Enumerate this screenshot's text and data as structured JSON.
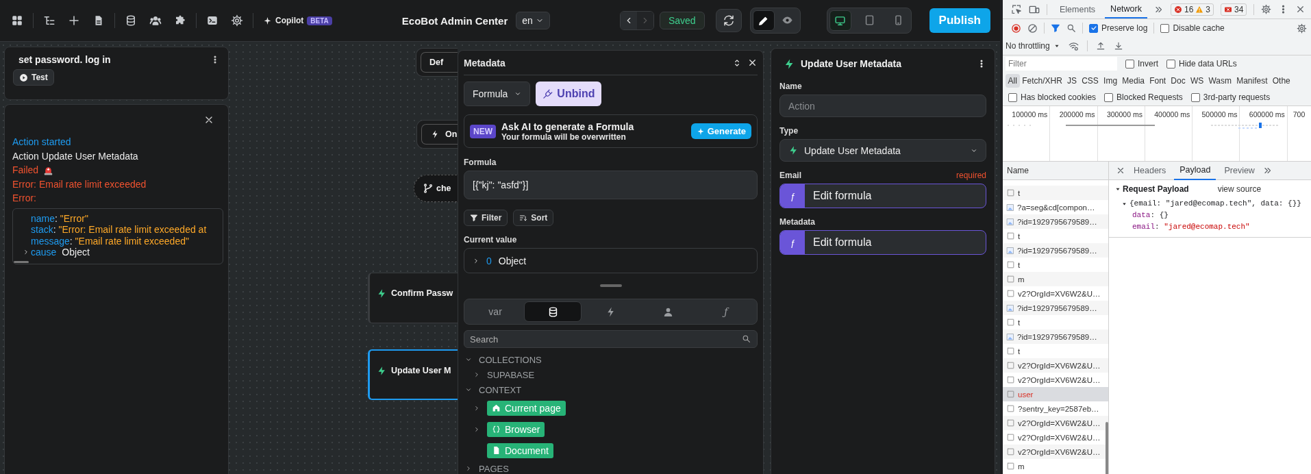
{
  "toolbar": {
    "copilot": "Copilot",
    "copilot_badge": "BETA",
    "title": "EcoBot Admin Center",
    "language": "en",
    "history": [
      {
        "disabled": false
      },
      {
        "disabled": true
      }
    ],
    "status": "Saved",
    "modes": [
      {
        "selected": true
      },
      {
        "selected": false
      }
    ],
    "devices": [
      {
        "selected": true
      },
      {
        "selected": false
      },
      {
        "selected": false
      }
    ],
    "publish": "Publish"
  },
  "workflow": {
    "title": "set password. log in",
    "test": "Test"
  },
  "log": {
    "lines": [
      {
        "text": "Action started",
        "kind": "info"
      },
      {
        "text": "Action Update User Metadata",
        "kind": "plain"
      },
      {
        "text": "Failed",
        "kind": "failed"
      },
      {
        "text": "Error: Email rate limit exceeded",
        "kind": "error"
      },
      {
        "text": "Error:",
        "kind": "error"
      }
    ],
    "error_object": [
      {
        "key": "name",
        "separator": ":",
        "value": "\"Error\"",
        "kind": "string"
      },
      {
        "key": "stack",
        "separator": ":",
        "value": "\"Error: Email rate limit exceeded at",
        "kind": "string"
      },
      {
        "key": "message",
        "separator": ":",
        "value": "\"Email rate limit exceeded\"",
        "kind": "string"
      },
      {
        "key": "cause",
        "value": "Object",
        "kind": "object",
        "expanded": false
      }
    ]
  },
  "canvas": {
    "nodes": [
      {
        "label": "Def",
        "kind": "box",
        "selected": false
      },
      {
        "label": "On",
        "kind": "trigger",
        "selected": false
      },
      {
        "label": "che",
        "kind": "branch",
        "selected": false
      },
      {
        "label": "Confirm Passw",
        "kind": "action",
        "selected": false
      },
      {
        "label": "Update User M",
        "kind": "action",
        "selected": true
      }
    ]
  },
  "formula_panel": {
    "title": "Metadata",
    "mode": "Formula",
    "unbind": "Unbind",
    "ai": {
      "badge": "NEW",
      "title": "Ask AI to generate a Formula",
      "subtitle": "Your formula will be overwritten",
      "button": "Generate"
    },
    "formula_label": "Formula",
    "formula": "[{\"kj\": \"asfd\"}]",
    "filter": "Filter",
    "sort": "Sort",
    "current_label": "Current value",
    "current": {
      "index": "0",
      "type": "Object",
      "expanded": false
    },
    "tabs": [
      {
        "label": "var",
        "kind": "text",
        "selected": false
      },
      {
        "kind": "database",
        "selected": true
      },
      {
        "kind": "workflow",
        "selected": false
      },
      {
        "kind": "user",
        "selected": false
      },
      {
        "label": "ƒ",
        "kind": "text",
        "selected": false
      }
    ],
    "search": {
      "placeholder": "Search"
    },
    "tree": [
      {
        "label": "COLLECTIONS",
        "kind": "group",
        "expanded": true,
        "children": [
          {
            "label": "SUPABASE",
            "kind": "group",
            "expanded": false
          }
        ]
      },
      {
        "label": "CONTEXT",
        "kind": "group",
        "expanded": true,
        "children": [
          {
            "label": "Current page",
            "kind": "chip",
            "expanded": false
          },
          {
            "label": "Browser",
            "kind": "chip",
            "expanded": false
          },
          {
            "label": "Document",
            "kind": "chip"
          }
        ]
      },
      {
        "label": "PAGES",
        "kind": "group",
        "expanded": false
      }
    ]
  },
  "action_panel": {
    "title": "Update User Metadata",
    "fields": [
      {
        "label": "Name",
        "kind": "text",
        "placeholder": "Action"
      },
      {
        "label": "Type",
        "kind": "select",
        "value": "Update User Metadata"
      },
      {
        "label": "Email",
        "kind": "formula",
        "required": "required",
        "symbol": "ƒ",
        "value": "Edit formula"
      },
      {
        "label": "Metadata",
        "kind": "formula",
        "symbol": "ƒ",
        "value": "Edit formula"
      }
    ]
  },
  "devtools": {
    "tabs": [
      {
        "label": "Elements",
        "selected": false
      },
      {
        "label": "Network",
        "selected": true
      }
    ],
    "errors": "16",
    "warnings": "3",
    "issues": "34",
    "preserve_log": {
      "label": "Preserve log",
      "checked": true
    },
    "disable_cache": {
      "label": "Disable cache",
      "checked": false
    },
    "throttling": "No throttling",
    "filter": {
      "placeholder": "Filter"
    },
    "filter_options": [
      {
        "label": "Invert",
        "checked": false
      },
      {
        "label": "Hide data URLs",
        "checked": false
      }
    ],
    "types": [
      {
        "label": "All",
        "selected": true
      },
      {
        "label": "Fetch/XHR",
        "selected": false
      },
      {
        "label": "JS",
        "selected": false
      },
      {
        "label": "CSS",
        "selected": false
      },
      {
        "label": "Img",
        "selected": false
      },
      {
        "label": "Media",
        "selected": false
      },
      {
        "label": "Font",
        "selected": false
      },
      {
        "label": "Doc",
        "selected": false
      },
      {
        "label": "WS",
        "selected": false
      },
      {
        "label": "Wasm",
        "selected": false
      },
      {
        "label": "Manifest",
        "selected": false
      },
      {
        "label": "Othe",
        "selected": false
      }
    ],
    "blocked_options": [
      {
        "label": "Has blocked cookies",
        "checked": false
      },
      {
        "label": "Blocked Requests",
        "checked": false
      },
      {
        "label": "3rd-party requests",
        "checked": false
      }
    ],
    "timeline_ticks": [
      "100000 ms",
      "200000 ms",
      "300000 ms",
      "400000 ms",
      "500000 ms",
      "600000 ms",
      "700"
    ],
    "requests": {
      "header": "Name",
      "rows": [
        {
          "name": "t",
          "kind": "file",
          "selected": false,
          "failed": false
        },
        {
          "name": "?a=seg&cd[compon…",
          "kind": "image",
          "selected": false,
          "failed": false
        },
        {
          "name": "?id=1929795679589…",
          "kind": "image",
          "selected": false,
          "failed": false
        },
        {
          "name": "t",
          "kind": "file",
          "selected": false,
          "failed": false
        },
        {
          "name": "?id=1929795679589…",
          "kind": "image",
          "selected": false,
          "failed": false
        },
        {
          "name": "t",
          "kind": "file",
          "selected": false,
          "failed": false
        },
        {
          "name": "m",
          "kind": "file",
          "selected": false,
          "failed": false
        },
        {
          "name": "v2?OrgId=XV6W2&U…",
          "kind": "file",
          "selected": false,
          "failed": false
        },
        {
          "name": "?id=1929795679589…",
          "kind": "image",
          "selected": false,
          "failed": false
        },
        {
          "name": "t",
          "kind": "file",
          "selected": false,
          "failed": false
        },
        {
          "name": "?id=1929795679589…",
          "kind": "image",
          "selected": false,
          "failed": false
        },
        {
          "name": "t",
          "kind": "file",
          "selected": false,
          "failed": false
        },
        {
          "name": "v2?OrgId=XV6W2&U…",
          "kind": "file",
          "selected": false,
          "failed": false
        },
        {
          "name": "v2?OrgId=XV6W2&U…",
          "kind": "file",
          "selected": false,
          "failed": false
        },
        {
          "name": "user",
          "kind": "file",
          "selected": true,
          "failed": true
        },
        {
          "name": "?sentry_key=2587eb…",
          "kind": "file",
          "selected": false,
          "failed": false
        },
        {
          "name": "v2?OrgId=XV6W2&U…",
          "kind": "file",
          "selected": false,
          "failed": false
        },
        {
          "name": "v2?OrgId=XV6W2&U…",
          "kind": "file",
          "selected": false,
          "failed": false
        },
        {
          "name": "v2?OrgId=XV6W2&U…",
          "kind": "file",
          "selected": false,
          "failed": false
        },
        {
          "name": "m",
          "kind": "file",
          "selected": false,
          "failed": false
        }
      ]
    },
    "detail_tabs": [
      {
        "label": "Headers",
        "selected": false
      },
      {
        "label": "Payload",
        "selected": true
      },
      {
        "label": "Preview",
        "selected": false
      }
    ],
    "payload": {
      "title": "Request Payload",
      "view_source": "view source",
      "summary": "{email: \"jared@ecomap.tech\", data: {}}",
      "expanded": true,
      "entries": [
        {
          "key": "data",
          "separator": ":",
          "value": "{}",
          "kind": "object"
        },
        {
          "key": "email",
          "separator": ":",
          "value": "\"jared@ecomap.tech\"",
          "kind": "string"
        }
      ]
    }
  }
}
